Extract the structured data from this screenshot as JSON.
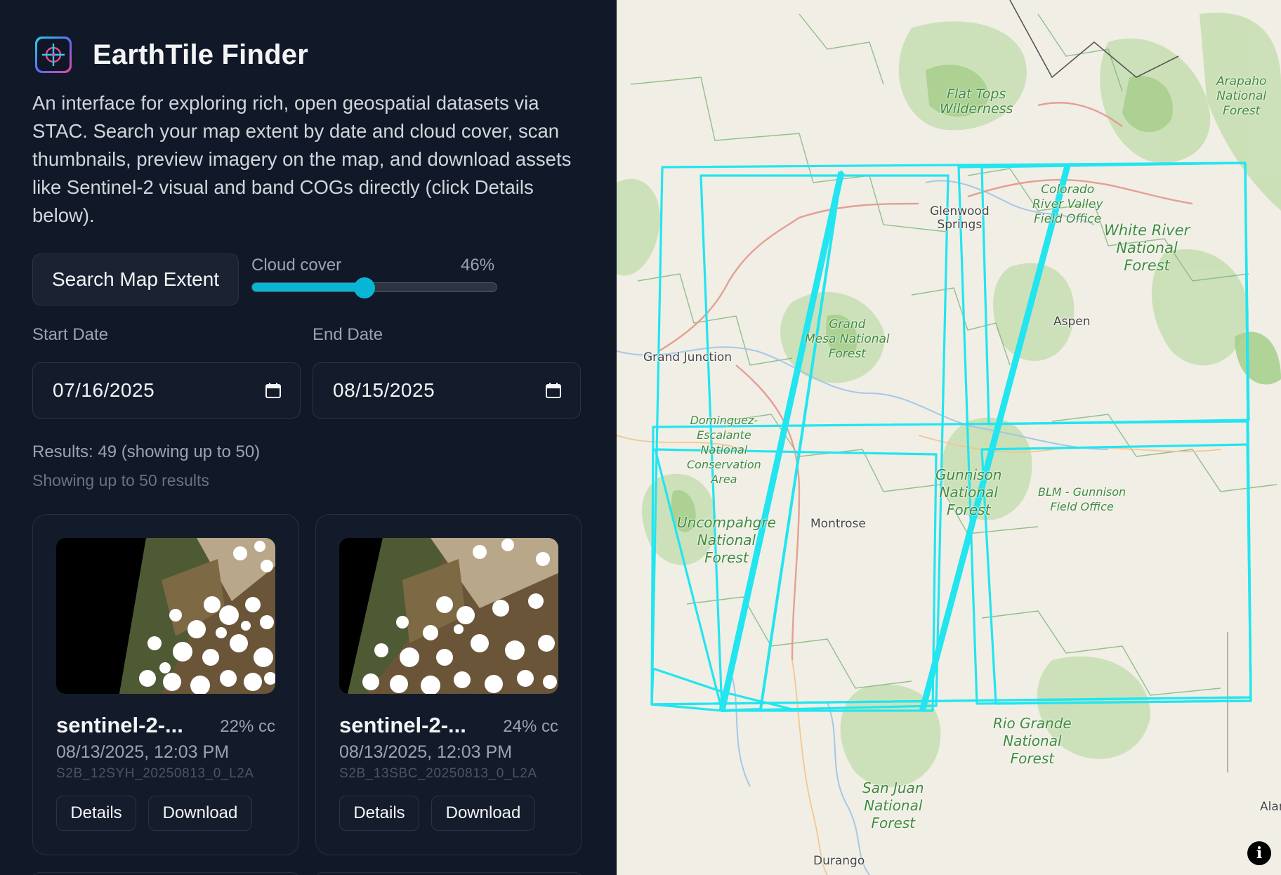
{
  "app": {
    "title": "EarthTile Finder",
    "description": "An interface for exploring rich, open geospatial datasets via STAC. Search your map extent by date and cloud cover, scan thumbnails, preview imagery on the map, and download assets like Sentinel-2 visual and band COGs directly (click Details below).",
    "logo_icon": "crosshair-icon"
  },
  "controls": {
    "search_label": "Search Map Extent",
    "cloud_cover_label": "Cloud cover",
    "cloud_cover_value": "46%",
    "cloud_cover_fraction": 0.46,
    "start_date_label": "Start Date",
    "start_date_value": "07/16/2025",
    "end_date_label": "End Date",
    "end_date_value": "08/15/2025",
    "calendar_icon": "calendar-icon"
  },
  "results": {
    "summary": "Results: 49 (showing up to 50)",
    "note": "Showing up to 50 results"
  },
  "cards": [
    {
      "title": "sentinel-2-...",
      "cloud_cover": "22% cc",
      "datetime": "08/13/2025, 12:03 PM",
      "item_id": "S2B_12SYH_20250813_0_L2A",
      "details_label": "Details",
      "download_label": "Download"
    },
    {
      "title": "sentinel-2-...",
      "cloud_cover": "24% cc",
      "datetime": "08/13/2025, 12:03 PM",
      "item_id": "S2B_13SBC_20250813_0_L2A",
      "details_label": "Details",
      "download_label": "Download"
    }
  ],
  "map": {
    "footprint_color": "#22e5f0",
    "labels": {
      "flat_tops": "Flat Tops\nWilderness",
      "arapaho": "Arapaho\nNational\nForest",
      "colorado_river": "Colorado\nRiver Valley\nField Office",
      "white_river": "White River\nNational\nForest",
      "grand_mesa": "Grand\nMesa National\nForest",
      "dominguez": "Dominguez-\nEscalante\nNational\nConservation\nArea",
      "gunnison_nf": "Gunnison\nNational\nForest",
      "blm_gunnison": "BLM - Gunnison\nField Office",
      "uncompahgre": "Uncompahgre\nNational\nForest",
      "rio_grande": "Rio Grande\nNational\nForest",
      "san_juan": "San Juan\nNational\nForest"
    },
    "towns": {
      "glenwood": "Glenwood\nSprings",
      "aspen": "Aspen",
      "grand_junction": "Grand Junction",
      "montrose": "Montrose",
      "durango": "Durango",
      "alamosa": "Alar"
    },
    "info_glyph": "i"
  }
}
